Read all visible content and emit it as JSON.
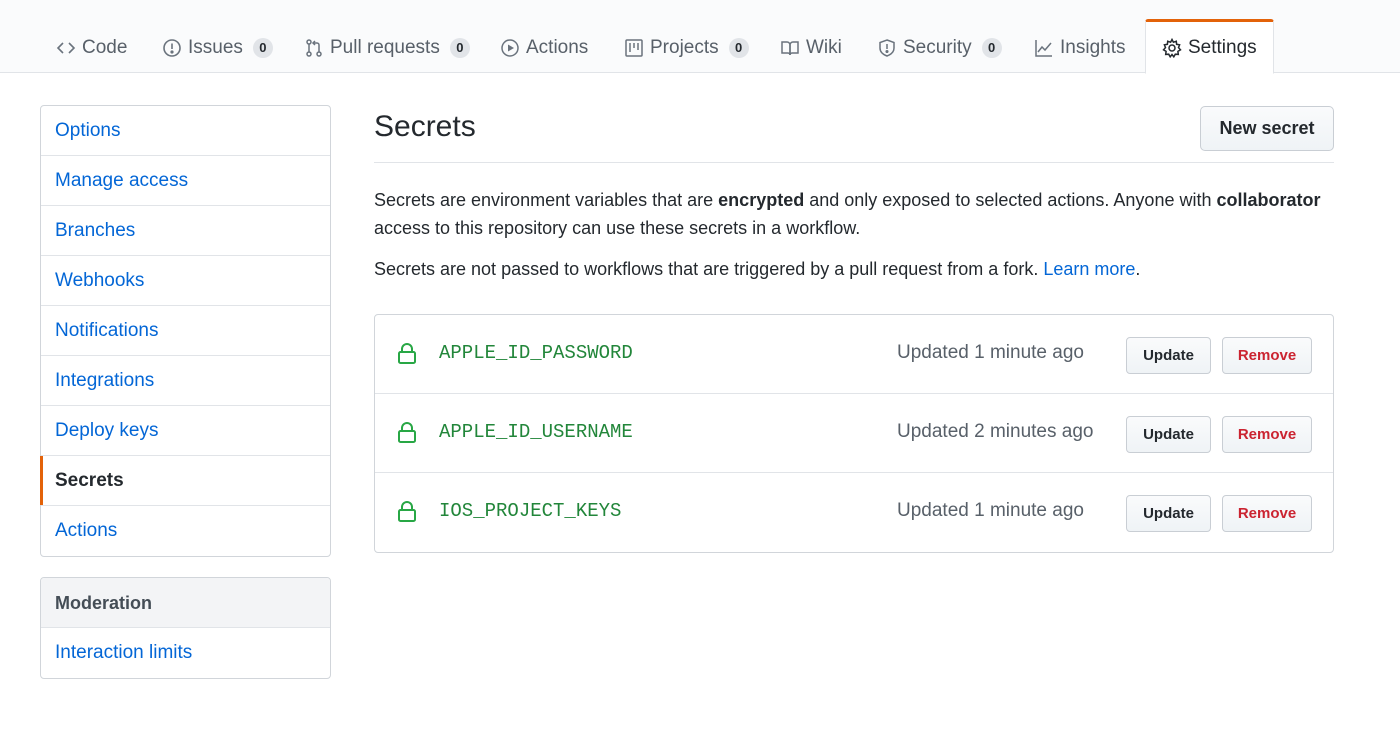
{
  "tabs": [
    {
      "label": "Code",
      "icon": "code-icon"
    },
    {
      "label": "Issues",
      "icon": "issue-icon",
      "count": "0"
    },
    {
      "label": "Pull requests",
      "icon": "pull-request-icon",
      "count": "0"
    },
    {
      "label": "Actions",
      "icon": "play-icon"
    },
    {
      "label": "Projects",
      "icon": "project-icon",
      "count": "0"
    },
    {
      "label": "Wiki",
      "icon": "book-icon"
    },
    {
      "label": "Security",
      "icon": "shield-icon",
      "count": "0"
    },
    {
      "label": "Insights",
      "icon": "graph-icon"
    },
    {
      "label": "Settings",
      "icon": "gear-icon",
      "selected": true
    }
  ],
  "sidebar": {
    "items": [
      {
        "label": "Options"
      },
      {
        "label": "Manage access"
      },
      {
        "label": "Branches"
      },
      {
        "label": "Webhooks"
      },
      {
        "label": "Notifications"
      },
      {
        "label": "Integrations"
      },
      {
        "label": "Deploy keys"
      },
      {
        "label": "Secrets",
        "selected": true
      },
      {
        "label": "Actions"
      }
    ],
    "moderation": {
      "heading": "Moderation",
      "items": [
        {
          "label": "Interaction limits"
        }
      ]
    }
  },
  "main": {
    "title": "Secrets",
    "new_button": "New secret",
    "desc1": {
      "p1": "Secrets are environment variables that are ",
      "b1": "encrypted",
      "p2": " and only exposed to selected actions. Anyone with ",
      "b2": "collaborator",
      "p3": " access to this repository can use these secrets in a workflow."
    },
    "desc2": {
      "text": "Secrets are not passed to workflows that are triggered by a pull request from a fork. ",
      "link": "Learn more",
      "end": "."
    },
    "secrets": [
      {
        "name": "APPLE_ID_PASSWORD",
        "updated": "Updated 1 minute ago",
        "update_label": "Update",
        "remove_label": "Remove"
      },
      {
        "name": "APPLE_ID_USERNAME",
        "updated": "Updated 2 minutes ago",
        "update_label": "Update",
        "remove_label": "Remove"
      },
      {
        "name": "IOS_PROJECT_KEYS",
        "updated": "Updated 1 minute ago",
        "update_label": "Update",
        "remove_label": "Remove"
      }
    ]
  },
  "colors": {
    "link": "#0366d6",
    "accent": "#e36209",
    "secret_name": "#22863a",
    "lock": "#28a745",
    "danger": "#cb2431"
  }
}
